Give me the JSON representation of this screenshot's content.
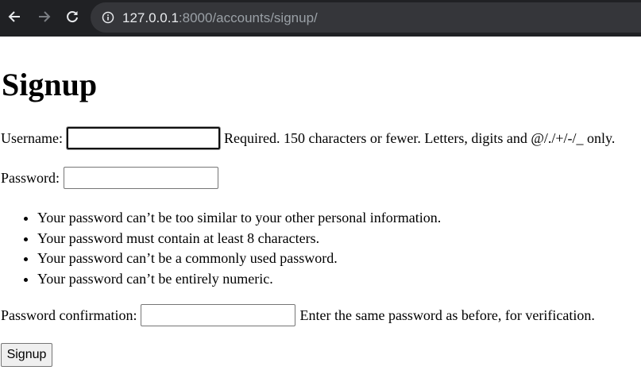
{
  "browser": {
    "url_host": "127.0.0.1",
    "url_rest": ":8000/accounts/signup/"
  },
  "page": {
    "title": "Signup"
  },
  "form": {
    "username_label": "Username:",
    "username_help": "Required. 150 characters or fewer. Letters, digits and @/./+/-/_ only.",
    "password_label": "Password:",
    "password_rules": [
      "Your password can’t be too similar to your other personal information.",
      "Your password must contain at least 8 characters.",
      "Your password can’t be a commonly used password.",
      "Your password can’t be entirely numeric."
    ],
    "confirm_label": "Password confirmation:",
    "confirm_help": "Enter the same password as before, for verification.",
    "submit_label": "Signup"
  }
}
